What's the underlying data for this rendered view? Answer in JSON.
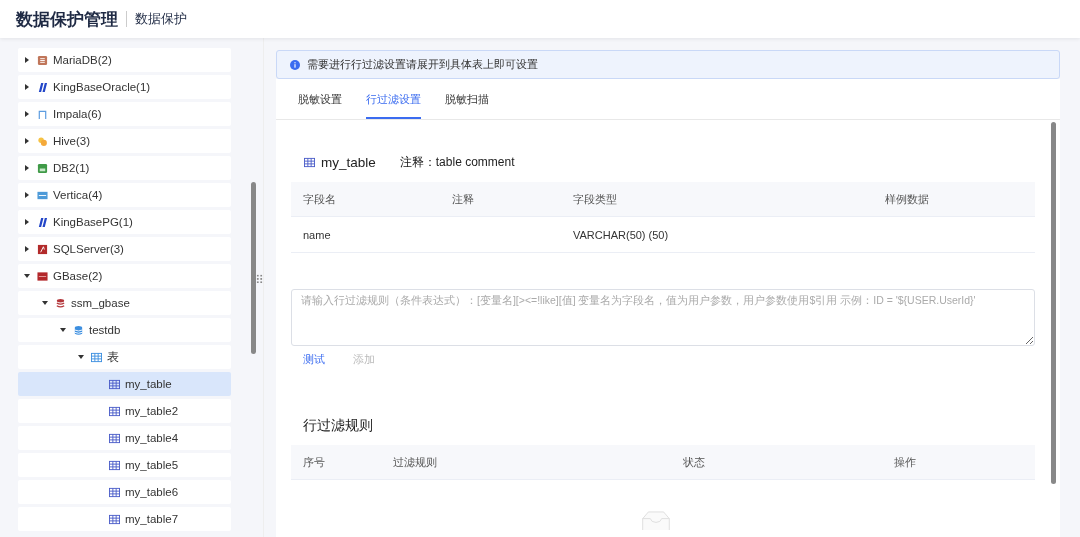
{
  "header": {
    "title": "数据保护管理",
    "subtitle": "数据保护"
  },
  "tree": [
    {
      "label": "MariaDB(2)",
      "kind": "mariadb",
      "expanded": false,
      "selected": false
    },
    {
      "label": "KingBaseOracle(1)",
      "kind": "kingbase",
      "expanded": false,
      "selected": false
    },
    {
      "label": "Impala(6)",
      "kind": "impala",
      "expanded": false,
      "selected": false
    },
    {
      "label": "Hive(3)",
      "kind": "hive",
      "expanded": false,
      "selected": false
    },
    {
      "label": "DB2(1)",
      "kind": "db2",
      "expanded": false,
      "selected": false
    },
    {
      "label": "Vertica(4)",
      "kind": "vertica",
      "expanded": false,
      "selected": false
    },
    {
      "label": "KingBasePG(1)",
      "kind": "kingbase",
      "expanded": false,
      "selected": false
    },
    {
      "label": "SQLServer(3)",
      "kind": "sqlserver",
      "expanded": false,
      "selected": false
    },
    {
      "label": "GBase(2)",
      "kind": "gbase",
      "expanded": true,
      "selected": false,
      "children": [
        {
          "label": "ssm_gbase",
          "kind": "instance",
          "expanded": true,
          "selected": false,
          "children": [
            {
              "label": "testdb",
              "kind": "database",
              "expanded": true,
              "selected": false,
              "children": [
                {
                  "label": "表",
                  "kind": "tables",
                  "expanded": true,
                  "selected": false,
                  "children": [
                    {
                      "label": "my_table",
                      "kind": "table",
                      "selected": true
                    },
                    {
                      "label": "my_table2",
                      "kind": "table",
                      "selected": false
                    },
                    {
                      "label": "my_table4",
                      "kind": "table",
                      "selected": false
                    },
                    {
                      "label": "my_table5",
                      "kind": "table",
                      "selected": false
                    },
                    {
                      "label": "my_table6",
                      "kind": "table",
                      "selected": false
                    },
                    {
                      "label": "my_table7",
                      "kind": "table",
                      "selected": false
                    }
                  ]
                }
              ]
            }
          ]
        }
      ]
    }
  ],
  "alert": "需要进行行过滤设置请展开到具体表上即可设置",
  "tabs": [
    {
      "label": "脱敏设置",
      "selected": false
    },
    {
      "label": "行过滤设置",
      "selected": true
    },
    {
      "label": "脱敏扫描",
      "selected": false
    }
  ],
  "table_info": {
    "name": "my_table",
    "comment": "注释：table comment"
  },
  "fields_table": {
    "columns": [
      "字段名",
      "注释",
      "字段类型",
      "样例数据"
    ],
    "rows": [
      [
        "name",
        "",
        "VARCHAR(50) (50)",
        ""
      ]
    ]
  },
  "rule_input": {
    "placeholder": "请输入行过滤规则（条件表达式）：[变量名][><=!like][值] 变量名为字段名，值为用户参数，用户参数使用$引用 示例：ID = '${USER.UserId}'"
  },
  "actions": [
    {
      "label": "测试",
      "disabled": false
    },
    {
      "label": "添加",
      "disabled": true
    }
  ],
  "rules_section": {
    "title": "行过滤规则",
    "columns": [
      "序号",
      "过滤规则",
      "状态",
      "操作"
    ]
  }
}
